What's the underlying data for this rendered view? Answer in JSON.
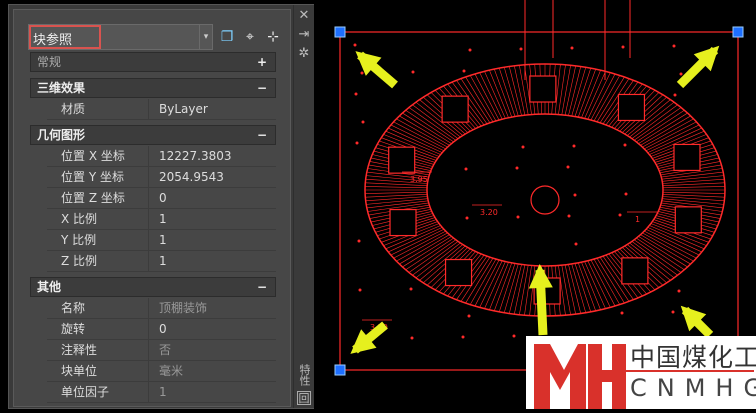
{
  "palette": {
    "dropdown": "块参照",
    "dropdown_arrow": "▾",
    "tools": [
      "quick-select-icon",
      "select-objects-icon",
      "toggle-pickadd-icon"
    ]
  },
  "strip": {
    "close": "✕",
    "pin": "⇥",
    "settings": "✲",
    "title": "特性",
    "menu": "回"
  },
  "sections": [
    {
      "title": "常规",
      "toggle": "+",
      "rows": []
    },
    {
      "title": "三维效果",
      "toggle": "−",
      "rows": [
        {
          "label": "材质",
          "value": "ByLayer"
        }
      ]
    },
    {
      "title": "几何图形",
      "toggle": "−",
      "rows": [
        {
          "label": "位置 X 坐标",
          "value": "12227.3803"
        },
        {
          "label": "位置 Y 坐标",
          "value": "2054.9543"
        },
        {
          "label": "位置 Z 坐标",
          "value": "0"
        },
        {
          "label": "X 比例",
          "value": "1"
        },
        {
          "label": "Y 比例",
          "value": "1"
        },
        {
          "label": "Z 比例",
          "value": "1"
        }
      ]
    },
    {
      "title": "其他",
      "toggle": "−",
      "rows": [
        {
          "label": "名称",
          "value": "顶棚装饰"
        },
        {
          "label": "旋转",
          "value": "0"
        },
        {
          "label": "注释性",
          "value": "否"
        },
        {
          "label": "块单位",
          "value": "毫米"
        },
        {
          "label": "单位因子",
          "value": "1"
        }
      ]
    }
  ],
  "drawing": {
    "dims": [
      "3.95",
      "3.20",
      "3.20",
      "1"
    ]
  },
  "watermark": {
    "mark": "MH",
    "cn": "中国煤化工",
    "en": "CNMHG"
  },
  "colors": {
    "cad_red": "#ff2a2a",
    "grip": "#1e6fff",
    "arrow": "#e6f01e"
  }
}
